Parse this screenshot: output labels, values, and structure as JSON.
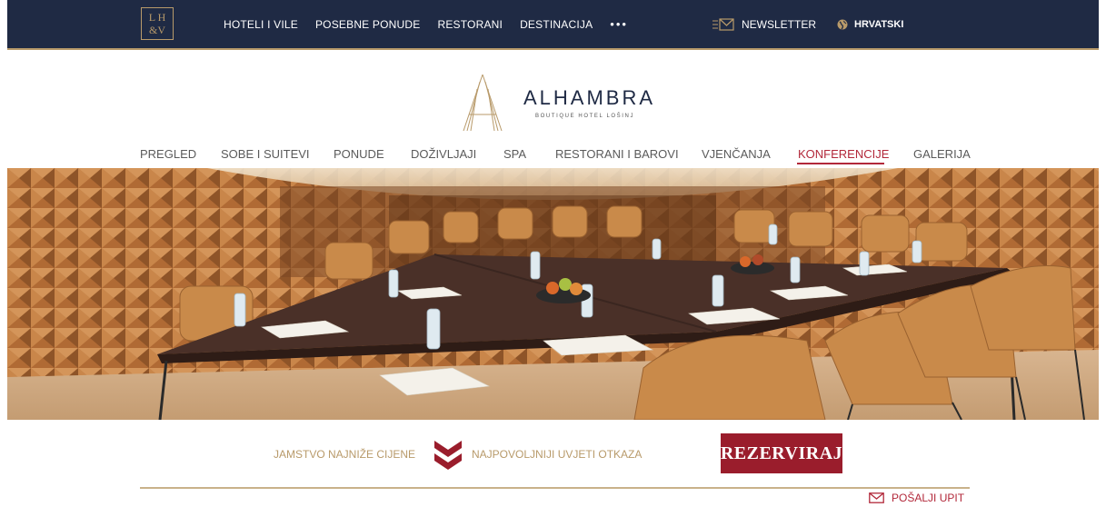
{
  "topbar": {
    "logo_line1": "L H",
    "logo_line2": "&V",
    "nav": [
      "HOTELI I VILE",
      "POSEBNE PONUDE",
      "RESTORANI",
      "DESTINACIJA"
    ],
    "more": "•••",
    "newsletter": "NEWSLETTER",
    "language": "HRVATSKI"
  },
  "brand": {
    "name": "ALHAMBRA",
    "tagline": "BOUTIQUE HOTEL LOŠINJ"
  },
  "main_nav": {
    "items": [
      "PREGLED",
      "SOBE I SUITEVI",
      "PONUDE",
      "DOŽIVLJAJI",
      "SPA",
      "RESTORANI I BAROVI",
      "VJENČANJA",
      "KONFERENCIJE",
      "GALERIJA"
    ],
    "active": "KONFERENCIJE"
  },
  "booking": {
    "guarantee": "JAMSTVO NAJNIŽE CIJENE",
    "conditions": "NAJPOVOLJNIJI UVJETI OTKAZA",
    "book_label": "REZERVIRAJ",
    "inquiry": "POŠALJI UPIT"
  },
  "colors": {
    "navy": "#1f2a44",
    "gold": "#b89a6a",
    "red": "#b2283a",
    "button": "#9a1d2c"
  },
  "icons": [
    "envelope-icon",
    "globe-icon",
    "logo-monogram-icon",
    "chevron-icon"
  ]
}
